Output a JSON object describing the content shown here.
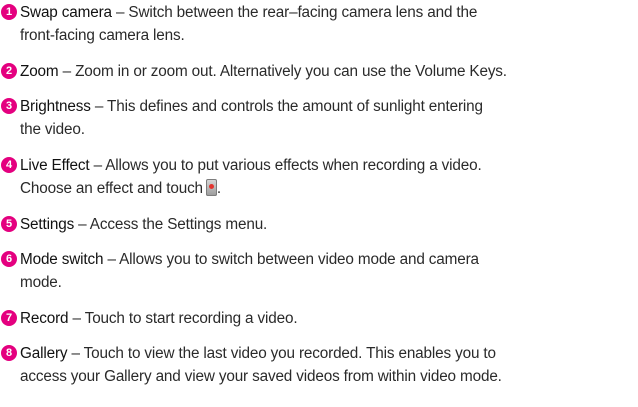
{
  "badge_color": "#e4007f",
  "items": [
    {
      "number": "1",
      "term": "Swap camera",
      "line1": " – Switch between the rear–facing camera lens and the",
      "line2": "front-facing camera lens."
    },
    {
      "number": "2",
      "term": "Zoom",
      "line1": " – Zoom in or zoom out. Alternatively you can use the Volume Keys."
    },
    {
      "number": "3",
      "term": "Brightness",
      "line1": " – This defines and controls the amount of sunlight entering",
      "line2": "the video."
    },
    {
      "number": "4",
      "term": "Live Effect",
      "line1": " – Allows you to put various effects when recording a video.",
      "line2": "Choose an effect and touch",
      "line2_end": ".",
      "inline_icon": "record-icon"
    },
    {
      "number": "5",
      "term": "Settings",
      "line1": " – Access the Settings menu."
    },
    {
      "number": "6",
      "term": "Mode switch",
      "line1": " – Allows you to switch between video mode and camera",
      "line2": "mode."
    },
    {
      "number": "7",
      "term": "Record",
      "line1": " – Touch to start recording a video."
    },
    {
      "number": "8",
      "term": "Gallery",
      "line1": " – Touch to view the last video you recorded. This enables you to",
      "line2": "access your Gallery and view your saved videos from within video mode."
    }
  ]
}
